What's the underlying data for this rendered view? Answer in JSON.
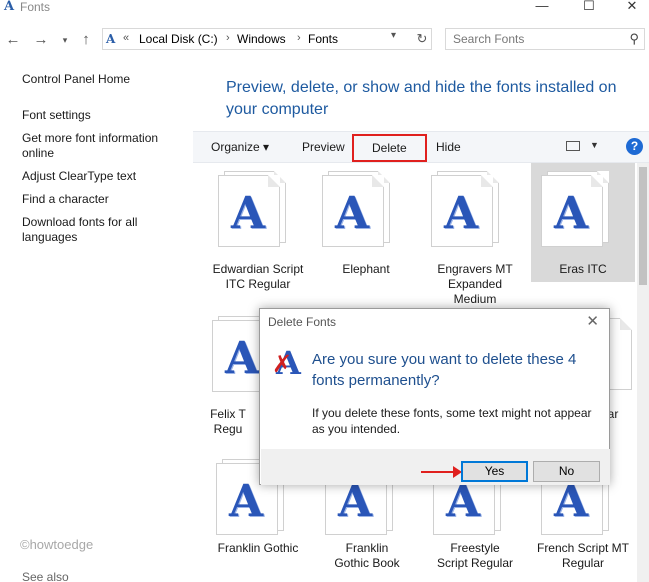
{
  "window": {
    "title": "Fonts",
    "minimize": "—",
    "maximize": "☐",
    "close": "✕"
  },
  "address": {
    "prefix": "«",
    "crumbs": [
      "Local Disk (C:)",
      "Windows",
      "Fonts"
    ],
    "search_placeholder": "Search Fonts"
  },
  "sidebar": {
    "items": [
      {
        "label": "Control Panel Home"
      },
      {
        "label": "Font settings"
      },
      {
        "label": "Get more font information online"
      },
      {
        "label": "Adjust ClearType text"
      },
      {
        "label": "Find a character"
      },
      {
        "label": "Download fonts for all languages"
      }
    ],
    "see_also": "See also"
  },
  "watermark": "©howtoedge",
  "main": {
    "title": "Preview, delete, or show and hide the fonts installed on your computer"
  },
  "toolbar": {
    "organize": "Organize ▾",
    "preview": "Preview",
    "delete": "Delete",
    "hide": "Hide",
    "view_dropdown": "▼",
    "help": "?"
  },
  "fonts": [
    {
      "label": "Edwardian Script ITC Regular"
    },
    {
      "label": "Elephant"
    },
    {
      "label": "Engravers MT Expanded Medium"
    },
    {
      "label": "Eras ITC"
    },
    {
      "label": "Felix T Regu"
    },
    {
      "label": "ar"
    },
    {
      "label": "Franklin Gothic"
    },
    {
      "label": "Franklin Gothic Book"
    },
    {
      "label": "Freestyle Script Regular"
    },
    {
      "label": "French Script MT Regular"
    }
  ],
  "glyph": "A",
  "dialog": {
    "title": "Delete Fonts",
    "close": "✕",
    "question": "Are you sure you want to delete these 4 fonts permanently?",
    "info": "If you delete these fonts, some text might not appear as you intended.",
    "yes": "Yes",
    "no": "No"
  },
  "colors": {
    "accent": "#1e5aa0",
    "highlight": "#e0201e",
    "selected_tile": "#d9d9d9"
  }
}
